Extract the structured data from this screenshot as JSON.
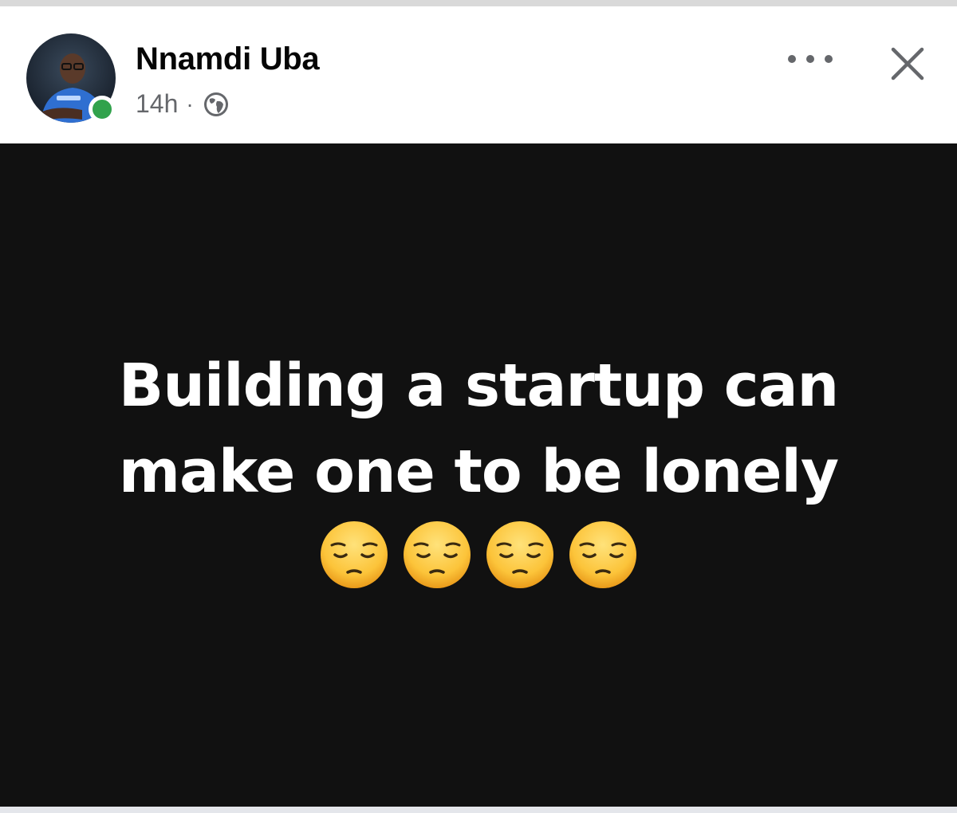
{
  "post": {
    "author": "Nnamdi Uba",
    "time": "14h",
    "separator": "·",
    "privacy_icon": "globe-icon",
    "text": "Building a startup can make one to be lonely",
    "emoji_icon": "pensive-face-icon",
    "emoji_count": 4
  },
  "colors": {
    "online": "#31a24c",
    "post_background": "#111111",
    "post_text": "#ffffff",
    "meta_text": "#65676b"
  }
}
